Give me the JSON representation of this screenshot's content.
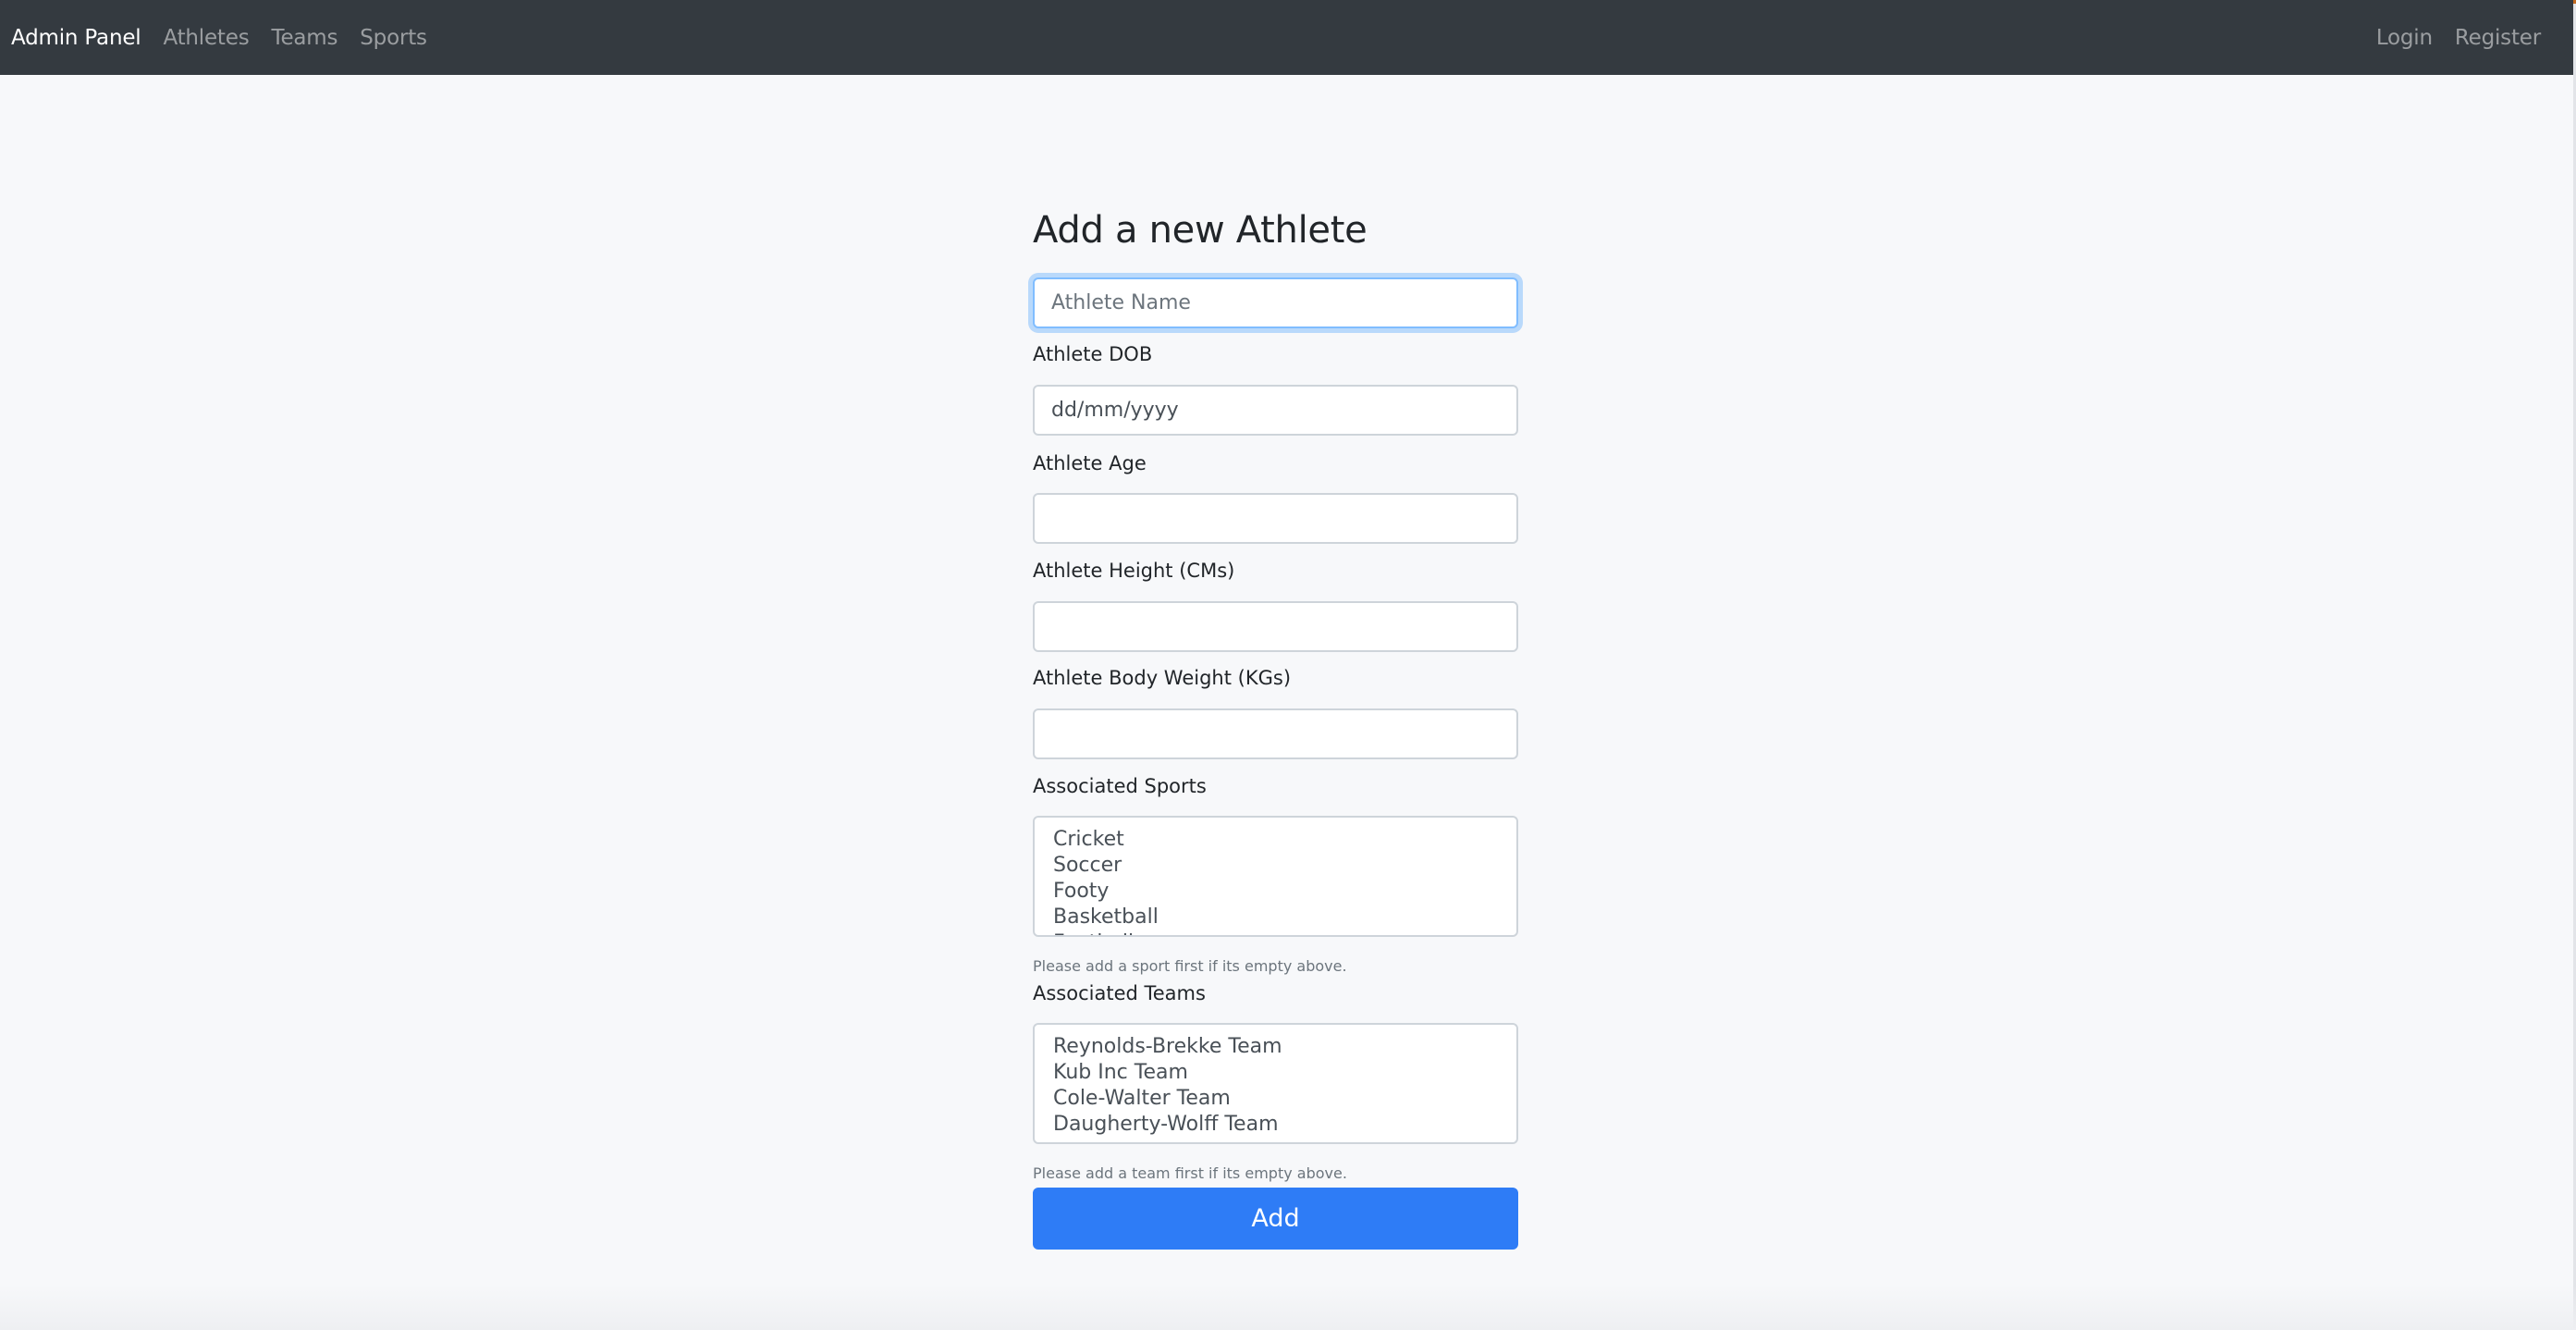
{
  "navbar": {
    "brand": "Admin Panel",
    "links": [
      "Athletes",
      "Teams",
      "Sports"
    ],
    "right_links": [
      "Login",
      "Register"
    ]
  },
  "form": {
    "title": "Add a new Athlete",
    "name_field": {
      "placeholder": "Athlete Name",
      "value": ""
    },
    "dob": {
      "label": "Athlete DOB",
      "display": "dd/mm/yyyy",
      "value": ""
    },
    "age": {
      "label": "Athlete Age",
      "value": ""
    },
    "height": {
      "label": "Athlete Height (CMs)",
      "value": ""
    },
    "weight": {
      "label": "Athlete Body Weight (KGs)",
      "value": ""
    },
    "sports": {
      "label": "Associated Sports",
      "options": [
        "Cricket",
        "Soccer",
        "Footy",
        "Basketball",
        "Football"
      ],
      "help": "Please add a sport first if its empty above."
    },
    "teams": {
      "label": "Associated Teams",
      "options": [
        "Reynolds-Brekke Team",
        "Kub Inc Team",
        "Cole-Walter Team",
        "Daugherty-Wolff Team"
      ],
      "help": "Please add a team first if its empty above."
    },
    "submit_label": "Add"
  },
  "colors": {
    "navbar_bg": "#343a40",
    "page_bg": "#f7f8fa",
    "primary": "#2e7cf6",
    "focus_border": "#80bdff"
  }
}
